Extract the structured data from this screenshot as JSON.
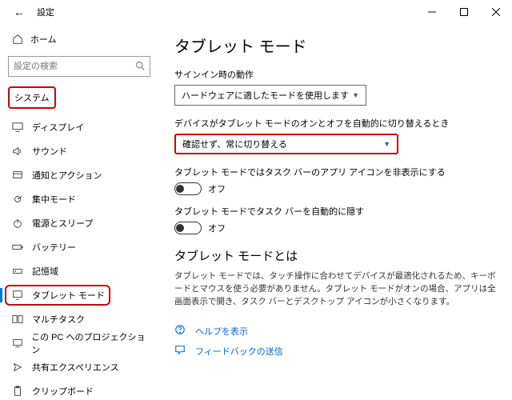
{
  "window": {
    "title": "設定"
  },
  "sidebar": {
    "home": "ホーム",
    "search_placeholder": "設定の検索",
    "category": "システム",
    "items": [
      {
        "label": "ディスプレイ"
      },
      {
        "label": "サウンド"
      },
      {
        "label": "通知とアクション"
      },
      {
        "label": "集中モード"
      },
      {
        "label": "電源とスリープ"
      },
      {
        "label": "バッテリー"
      },
      {
        "label": "記憶域"
      },
      {
        "label": "タブレット モード"
      },
      {
        "label": "マルチタスク"
      },
      {
        "label": "この PC へのプロジェクション"
      },
      {
        "label": "共有エクスペリエンス"
      },
      {
        "label": "クリップボード"
      }
    ]
  },
  "main": {
    "title": "タブレット モード",
    "signin_label": "サインイン時の動作",
    "signin_value": "ハードウェアに適したモードを使用します",
    "switch_label": "デバイスがタブレット モードのオンとオフを自動的に切り替えるとき",
    "switch_value": "確認せず、常に切り替える",
    "hide_icons_label": "タブレット モードではタスク バーのアプリ アイコンを非表示にする",
    "hide_icons_value": "オフ",
    "hide_taskbar_label": "タブレット モードでタスク バーを自動的に隠す",
    "hide_taskbar_value": "オフ",
    "about_title": "タブレット モードとは",
    "about_desc": "タブレット モードでは、タッチ操作に合わせてデバイスが最適化されるため、キーボードとマウスを使う必要がありません。タブレット モードがオンの場合、アプリは全画面表示で開き、タスク バーとデスクトップ アイコンが小さくなります。",
    "help_link": "ヘルプを表示",
    "feedback_link": "フィードバックの送信"
  }
}
